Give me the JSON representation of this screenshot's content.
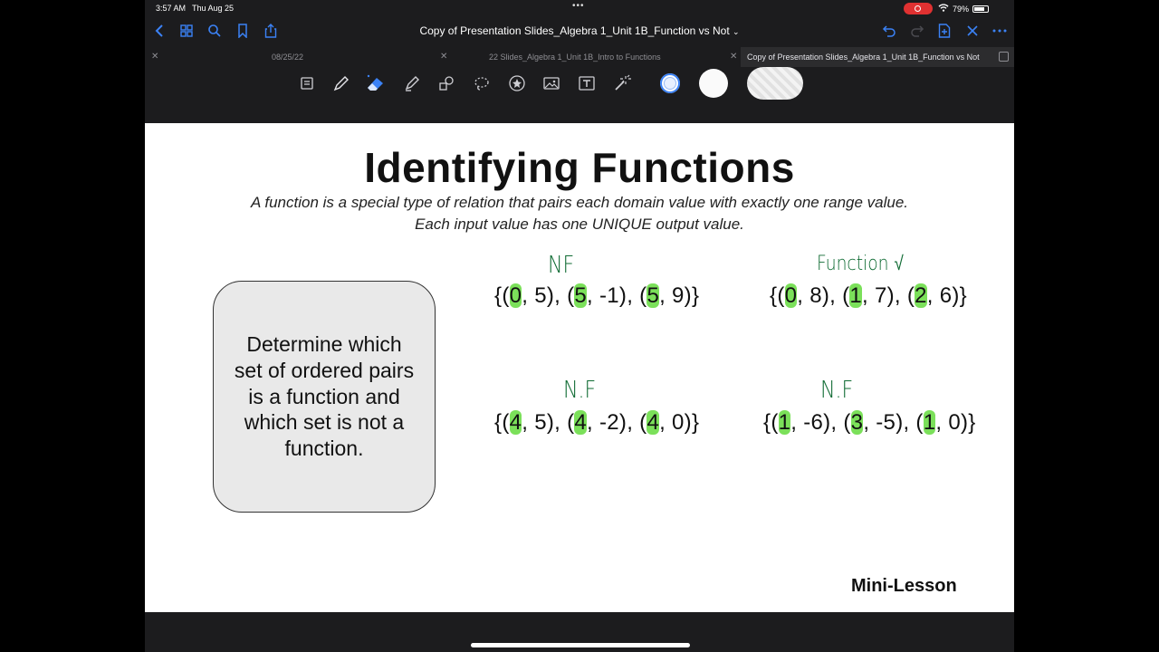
{
  "status_bar": {
    "time": "3:57 AM",
    "date": "Thu Aug 25",
    "battery": "79%"
  },
  "nav": {
    "title": "Copy of Presentation Slides_Algebra 1_Unit 1B_Function vs Not",
    "title_chevron": "⌄"
  },
  "tabs": [
    {
      "label": "08/25/22"
    },
    {
      "label": "22 Slides_Algebra 1_Unit 1B_Intro to Functions"
    },
    {
      "label": "Copy of Presentation Slides_Algebra 1_Unit 1B_Function vs Not"
    }
  ],
  "tools": [
    "page-icon",
    "pen-icon",
    "eraser-icon",
    "highlighter-icon",
    "shapes-icon",
    "lasso-icon",
    "sticker-icon",
    "image-icon",
    "textbox-icon",
    "laser-pointer-icon"
  ],
  "slide": {
    "title": "Identifying Functions",
    "definition_line1": "A function is a special type of relation that pairs each domain value with exactly one range value.",
    "definition_line2": "Each input value has one UNIQUE output value.",
    "task": "Determine which set of ordered pairs is a function and which set is not a function.",
    "footer": "Mini-Lesson",
    "sets": [
      {
        "annotation": "NF",
        "parts": [
          "{(",
          "0",
          ", 5), (",
          "5",
          ", -1), (",
          "5",
          ", 9)}"
        ]
      },
      {
        "annotation": "Function √",
        "parts": [
          "{(",
          "0",
          ", 8), (",
          "1",
          ", 7), (",
          "2",
          ", 6)}"
        ]
      },
      {
        "annotation": "N.F",
        "parts": [
          "{(",
          "4",
          ", 5), (",
          "4",
          ", -2), (",
          "4",
          ", 0)}"
        ]
      },
      {
        "annotation": "N.F",
        "parts": [
          "{(",
          "1",
          ", -6), (",
          "3",
          ", -5), (",
          "1",
          ", 0)}"
        ]
      }
    ]
  },
  "colors": {
    "highlight": "#7be05a",
    "ink": "#0f6b33",
    "accent": "#3b82f6"
  }
}
